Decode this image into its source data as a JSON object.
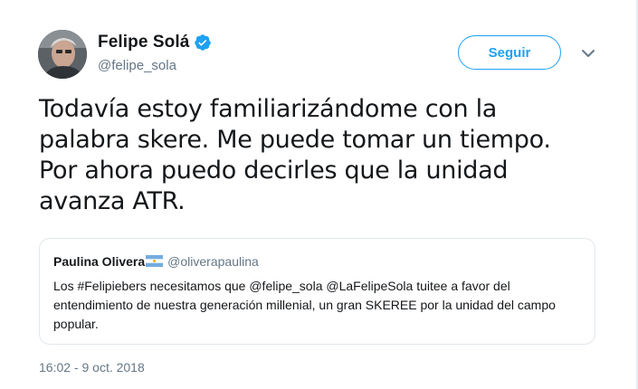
{
  "author": {
    "display_name": "Felipe Solá",
    "handle": "@felipe_sola"
  },
  "follow_button": {
    "label": "Seguir"
  },
  "tweet": {
    "text": "Todavía estoy familiarizándome con la palabra skere. Me puede tomar un tiempo. Por ahora puedo decirles que la unidad avanza ATR."
  },
  "quoted_tweet": {
    "display_name": "Paulina Olivera",
    "handle": "@oliverapaulina",
    "text": "Los #Felipiebers necesitamos que @felipe_sola @LaFelipeSola tuitee a favor del entendimiento de nuestra generación millenial, un gran SKEREE por la unidad del campo popular."
  },
  "timestamp": "16:02 - 9 oct. 2018",
  "colors": {
    "accent": "#1da1f2",
    "secondary_text": "#657786",
    "border": "#e1e8ed"
  },
  "icons": [
    "verified-icon",
    "chevron-down-icon",
    "argentina-flag-icon"
  ]
}
